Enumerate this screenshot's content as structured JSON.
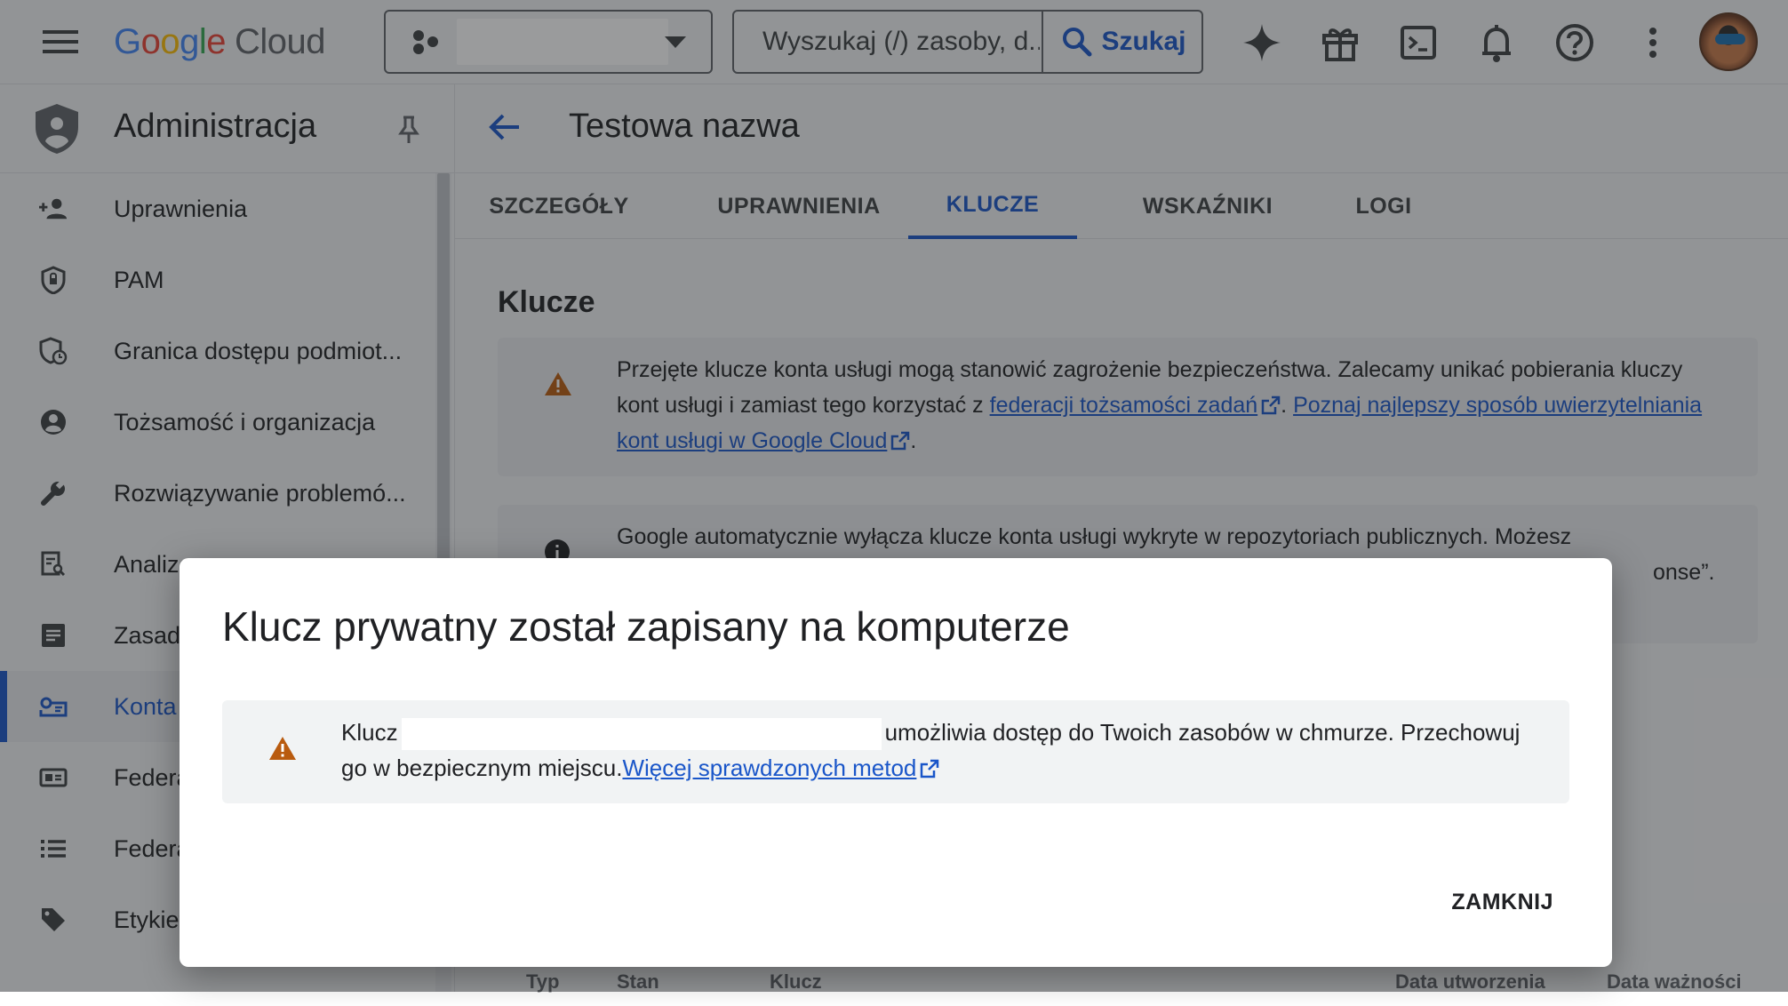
{
  "topbar": {
    "logo_google": [
      "G",
      "o",
      "o",
      "g",
      "l",
      "e"
    ],
    "logo_cloud": "Cloud",
    "search_placeholder": "Wyszukaj (/) zasoby, d..",
    "search_button": "Szukaj",
    "icons": [
      "menu-icon",
      "gemini-spark-icon",
      "gift-icon",
      "cloud-shell-icon",
      "notifications-bell-icon",
      "help-icon",
      "more-vert-icon"
    ]
  },
  "sidebar": {
    "title": "Administracja",
    "items": [
      {
        "label": "Uprawnienia",
        "icon": "person-add-icon"
      },
      {
        "label": "PAM",
        "icon": "shield-lock-icon"
      },
      {
        "label": "Granica dostępu podmiot...",
        "icon": "shield-clock-icon"
      },
      {
        "label": "Tożsamość i organizacja",
        "icon": "account-circle-icon"
      },
      {
        "label": "Rozwiązywanie problemó...",
        "icon": "wrench-icon"
      },
      {
        "label": "Analiza",
        "icon": "report-search-icon"
      },
      {
        "label": "Zasady",
        "icon": "list-document-icon"
      },
      {
        "label": "Konta",
        "icon": "service-account-key-icon",
        "active": true
      },
      {
        "label": "Federacja",
        "icon": "id-card-icon"
      },
      {
        "label": "Federacja",
        "icon": "list-icon"
      },
      {
        "label": "Etykiety",
        "icon": "label-tag-icon"
      }
    ]
  },
  "main": {
    "title": "Testowa nazwa",
    "tabs": [
      "SZCZEGÓŁY",
      "UPRAWNIENIA",
      "KLUCZE",
      "WSKAŹNIKI",
      "LOGI"
    ],
    "active_tab": "KLUCZE",
    "section_title": "Klucze",
    "warning_banner": {
      "text_1": "Przejęte klucze konta usługi mogą stanowić zagrożenie bezpieczeństwa. Zalecamy unikać pobierania kluczy kont usługi i zamiast tego korzystać z ",
      "link_1": "federacji tożsamości zadań",
      "sep": ". ",
      "link_2": "Poznaj najlepszy sposób uwierzytelniania kont usługi w Google Cloud",
      "end": "."
    },
    "info_banner": {
      "text": "Google automatycznie wyłącza klucze konta usługi wykryte w repozytoriach publicznych. Możesz",
      "text_tail": "onse”."
    },
    "table_headers": [
      "Typ",
      "Stan",
      "Klucz",
      "Data utworzenia",
      "Data ważności"
    ]
  },
  "dialog": {
    "title": "Klucz prywatny został zapisany na komputerze",
    "text_before": "Klucz",
    "text_after": "umożliwia dostęp do Twoich zasobów w chmurze. Przechowuj go w bezpiecznym miejscu.",
    "link": "Więcej sprawdzonych metod",
    "close": "ZAMKNIJ"
  },
  "colors": {
    "accent": "#1a56c9",
    "warning": "#b95b0f",
    "surface": "#f1f3f4"
  }
}
